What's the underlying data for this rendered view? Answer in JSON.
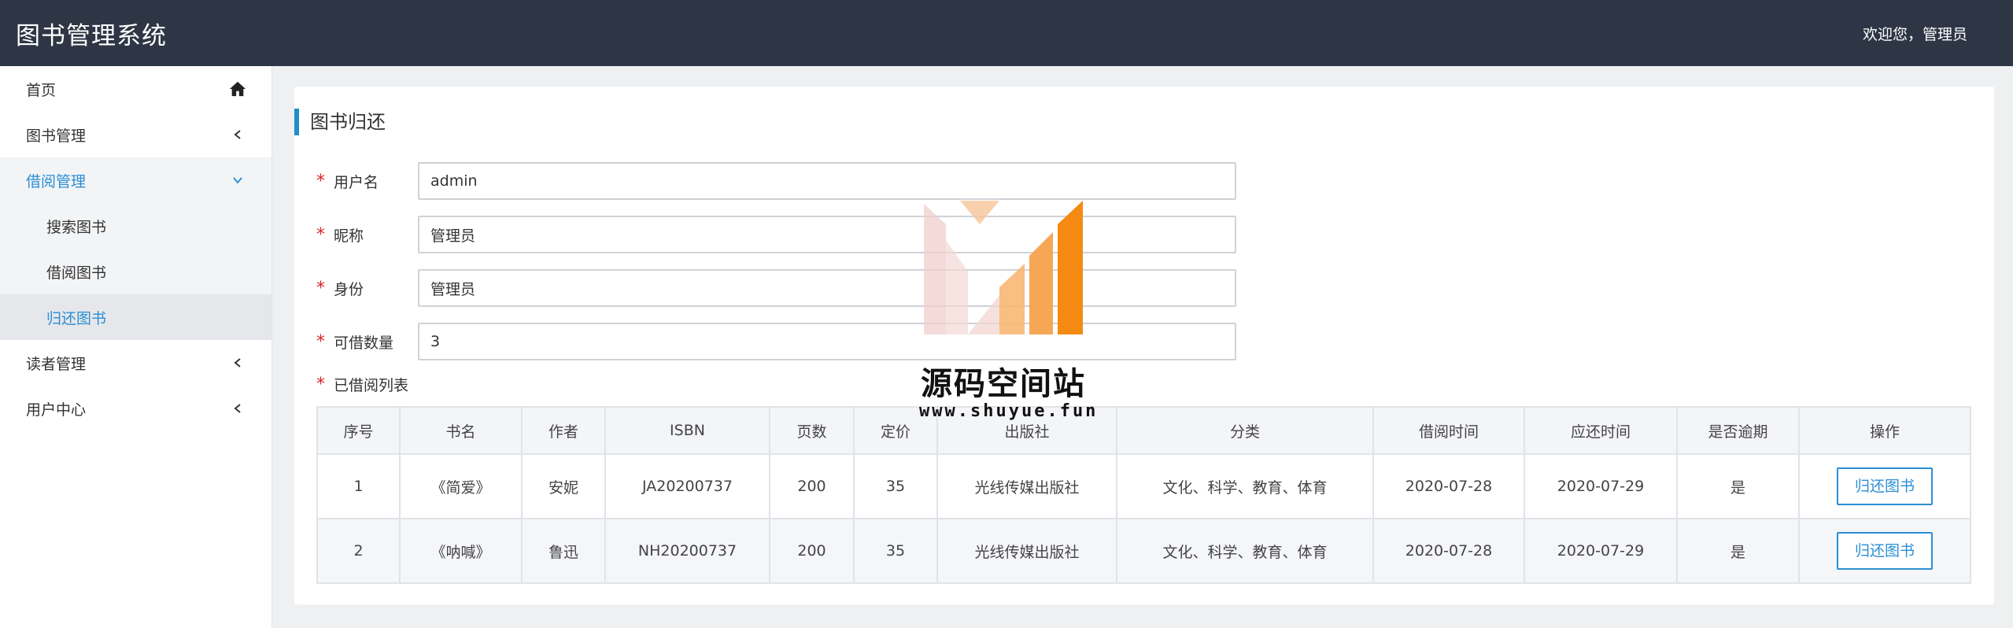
{
  "header": {
    "title": "图书管理系统",
    "welcome": "欢迎您，管理员"
  },
  "sidebar": {
    "items": [
      {
        "label": "首页",
        "icon": "home-icon"
      },
      {
        "label": "图书管理",
        "icon": "chevron-left-icon"
      },
      {
        "label": "借阅管理",
        "icon": "chevron-down-icon",
        "children": [
          "搜索图书",
          "借阅图书",
          "归还图书"
        ]
      },
      {
        "label": "读者管理",
        "icon": "chevron-left-icon"
      },
      {
        "label": "用户中心",
        "icon": "chevron-left-icon"
      }
    ]
  },
  "panel": {
    "title": "图书归还",
    "fields": [
      {
        "label": "用户名",
        "value": "admin"
      },
      {
        "label": "昵称",
        "value": "管理员"
      },
      {
        "label": "身份",
        "value": "管理员"
      },
      {
        "label": "可借数量",
        "value": "3"
      }
    ],
    "borrowed_label": "已借阅列表",
    "table": {
      "headers": [
        "序号",
        "书名",
        "作者",
        "ISBN",
        "页数",
        "定价",
        "出版社",
        "分类",
        "借阅时间",
        "应还时间",
        "是否逾期",
        "操作"
      ],
      "rows": [
        [
          "1",
          "《简爱》",
          "安妮",
          "JA20200737",
          "200",
          "35",
          "光线传媒出版社",
          "文化、科学、教育、体育",
          "2020-07-28",
          "2020-07-29",
          "是",
          "归还图书"
        ],
        [
          "2",
          "《呐喊》",
          "鲁迅",
          "NH20200737",
          "200",
          "35",
          "光线传媒出版社",
          "文化、科学、教育、体育",
          "2020-07-28",
          "2020-07-29",
          "是",
          "归还图书"
        ]
      ]
    }
  },
  "watermark": {
    "title": "源码空间站",
    "url": "www.shuyue.fun"
  },
  "colors": {
    "header_bg": "#2e3645",
    "accent": "#2b8ed5",
    "required": "#d9262c",
    "panel_marker": "#1e8fc9"
  }
}
